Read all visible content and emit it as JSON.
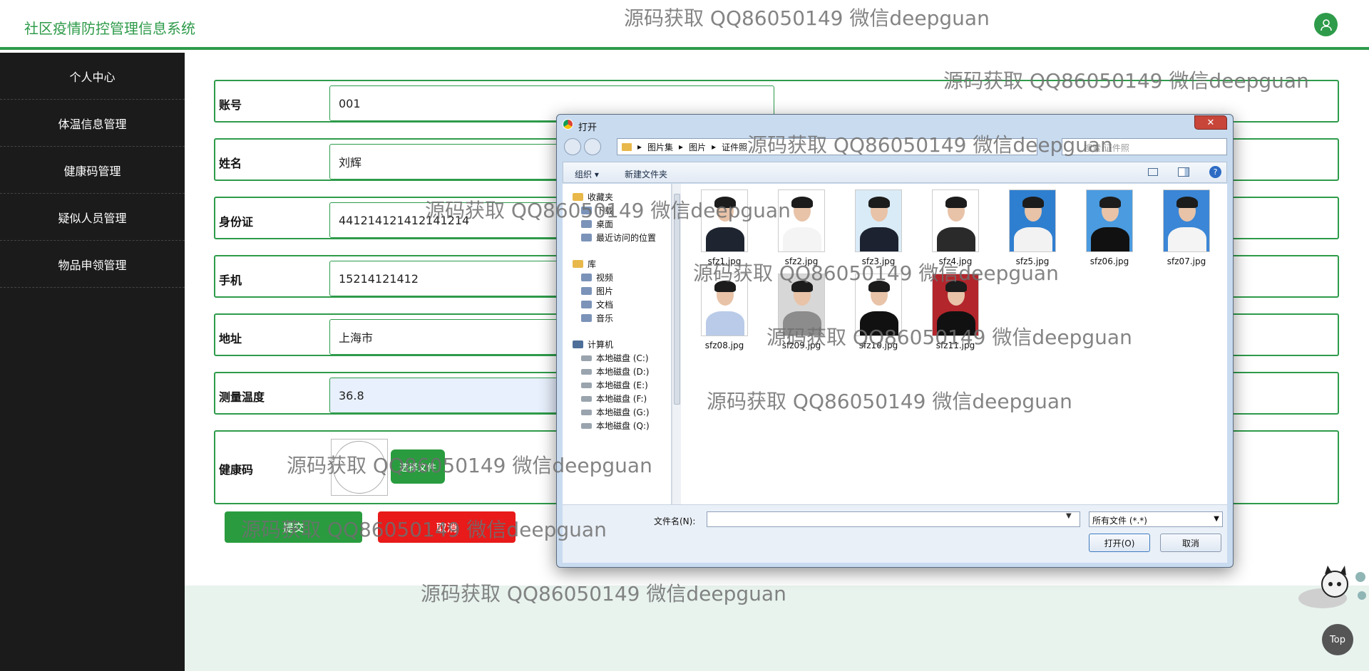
{
  "app": {
    "title": "社区疫情防控管理信息系统"
  },
  "sidebar": {
    "items": [
      {
        "label": "个人中心"
      },
      {
        "label": "体温信息管理"
      },
      {
        "label": "健康码管理"
      },
      {
        "label": "疑似人员管理"
      },
      {
        "label": "物品申领管理"
      }
    ]
  },
  "form": {
    "rows": [
      {
        "label": "账号",
        "value": "001"
      },
      {
        "label": "姓名",
        "value": "刘辉"
      },
      {
        "label": "身份证",
        "value": "441214121412141214"
      },
      {
        "label": "手机",
        "value": "15214121412"
      },
      {
        "label": "地址",
        "value": "上海市"
      },
      {
        "label": "测量温度",
        "value": "36.8"
      }
    ],
    "health_code_label": "健康码",
    "upload_button": "选择文件",
    "submit_button": "提交",
    "cancel_button": "取消"
  },
  "top_button": "Top",
  "dialog": {
    "title": "打开",
    "breadcrumb": [
      "图片集",
      "图片",
      "证件照"
    ],
    "search_placeholder": "搜索 证件照",
    "toolbar": {
      "organize": "组织 ▾",
      "new_folder": "新建文件夹",
      "help": "?"
    },
    "nav": {
      "favorites": "收藏夹",
      "fav_items": [
        "下载",
        "桌面",
        "最近访问的位置"
      ],
      "libraries": "库",
      "lib_items": [
        "视频",
        "图片",
        "文档",
        "音乐"
      ],
      "computer": "计算机",
      "drives": [
        "本地磁盘 (C:)",
        "本地磁盘 (D:)",
        "本地磁盘 (E:)",
        "本地磁盘 (F:)",
        "本地磁盘 (G:)",
        "本地磁盘 (Q:)"
      ]
    },
    "files": [
      {
        "name": "sfz1.jpg",
        "bg": "#ffffff",
        "suit": "#1e2530"
      },
      {
        "name": "sfz2.jpg",
        "bg": "#ffffff",
        "suit": "#f4f4f4"
      },
      {
        "name": "sfz3.jpg",
        "bg": "#d9ebf7",
        "suit": "#1c2230"
      },
      {
        "name": "sfz4.jpg",
        "bg": "#ffffff",
        "suit": "#2a2a2a"
      },
      {
        "name": "sfz5.jpg",
        "bg": "#2f7fd0",
        "suit": "#f2f2f2"
      },
      {
        "name": "sfz06.jpg",
        "bg": "#4a9be0",
        "suit": "#111111"
      },
      {
        "name": "sfz07.jpg",
        "bg": "#3b86d6",
        "suit": "#f4f4f4"
      },
      {
        "name": "sfz08.jpg",
        "bg": "#ffffff",
        "suit": "#b9cbe8"
      },
      {
        "name": "sfz09.jpg",
        "bg": "#d7d7d7",
        "suit": "#8c8c8c"
      },
      {
        "name": "sfz10.jpg",
        "bg": "#ffffff",
        "suit": "#111111"
      },
      {
        "name": "sfz11.jpg",
        "bg": "#b3262c",
        "suit": "#111111"
      }
    ],
    "filename_label": "文件名(N):",
    "filename_value": "",
    "filetype": "所有文件 (*.*)",
    "open_button": "打开(O)",
    "cancel_button": "取消",
    "close_button": "✕"
  },
  "watermark": "源码获取 QQ86050149 微信deepguan",
  "colors": {
    "accent": "#2e9b4a",
    "danger": "#e81a1a",
    "sidebar": "#1b1b1b"
  }
}
